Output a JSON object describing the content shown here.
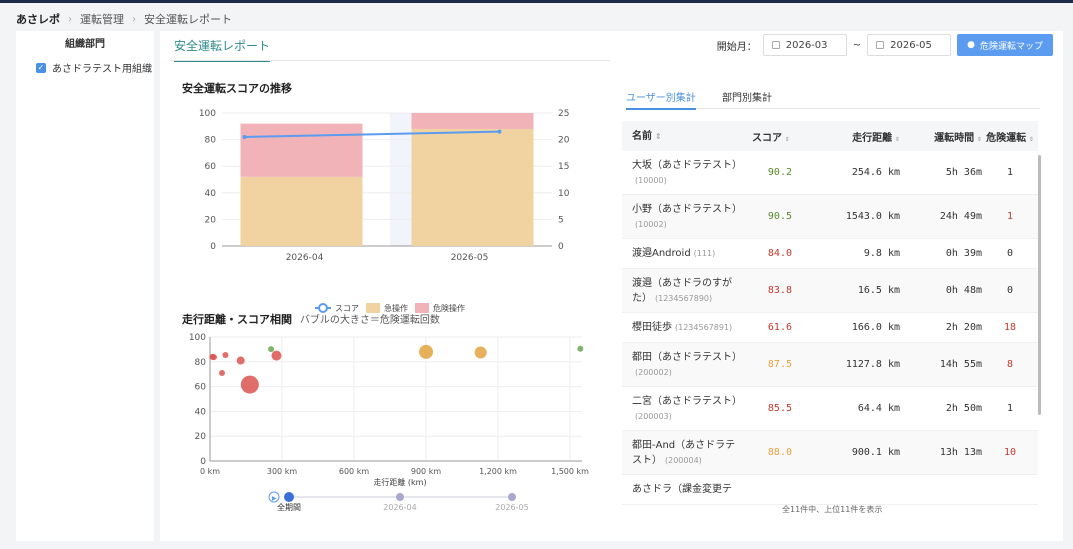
{
  "breadcrumb": {
    "home": "あさレポ",
    "level1": "運転管理",
    "level2": "安全運転レポート"
  },
  "sidebar": {
    "title": "組織部門",
    "org": "あさドラテスト用組織"
  },
  "main": {
    "tab": "安全運転レポート",
    "start_label": "開始月：",
    "start_value": "2026-03",
    "tilde": "~",
    "end_value": "2026-05",
    "map_button": "危険運転マップ"
  },
  "trend_chart": {
    "title": "安全運転スコアの推移",
    "left_ticks": [
      "100",
      "80",
      "60",
      "40",
      "20",
      "0"
    ],
    "right_ticks": [
      "25",
      "20",
      "15",
      "10",
      "5",
      "0"
    ],
    "categories": [
      "2026-04",
      "2026-05"
    ],
    "legend": {
      "score": "スコア",
      "sudden": "急操作",
      "danger": "危険操作"
    }
  },
  "bubble_chart": {
    "title": "走行距離・スコア相関",
    "subtitle": "バブルの大きさ＝危険運転回数",
    "y_ticks": [
      "100",
      "80",
      "60",
      "40",
      "20",
      "0"
    ],
    "x_ticks": [
      "0 km",
      "300 km",
      "600 km",
      "900 km",
      "1,200 km",
      "1,500 km"
    ],
    "xlabel": "走行距離 (km)",
    "timeline": [
      "全期間",
      "2026-04",
      "2026-05"
    ]
  },
  "chart_data": [
    {
      "type": "bar",
      "title": "安全運転スコアの推移",
      "categories": [
        "2026-04",
        "2026-05"
      ],
      "ylim_left": [
        0,
        100
      ],
      "ylim_right": [
        0,
        25
      ],
      "series": [
        {
          "name": "スコア",
          "type": "line",
          "axis": "right",
          "values": [
            20.5,
            21.5
          ]
        },
        {
          "name": "急操作",
          "type": "bar",
          "stack": "s",
          "axis": "left",
          "values": [
            52,
            88
          ]
        },
        {
          "name": "危険操作",
          "type": "bar",
          "stack": "s",
          "axis": "left",
          "values": [
            40,
            12
          ]
        }
      ]
    },
    {
      "type": "scatter",
      "title": "走行距離・スコア相関",
      "subtitle": "バブルの大きさ＝危険運転回数",
      "xlabel": "走行距離 (km)",
      "xlim": [
        0,
        1550
      ],
      "ylim": [
        0,
        100
      ],
      "points": [
        {
          "x": 9.8,
          "y": 84.0,
          "r": 3,
          "color": "#d9534f"
        },
        {
          "x": 16.5,
          "y": 83.8,
          "r": 3,
          "color": "#d9534f"
        },
        {
          "x": 64.4,
          "y": 85.5,
          "r": 3,
          "color": "#d9534f"
        },
        {
          "x": 50,
          "y": 71,
          "r": 3,
          "color": "#d9534f"
        },
        {
          "x": 128,
          "y": 81,
          "r": 4,
          "color": "#d9534f"
        },
        {
          "x": 166.0,
          "y": 61.6,
          "r": 9,
          "color": "#d9534f"
        },
        {
          "x": 254.6,
          "y": 90.2,
          "r": 3,
          "color": "#6aa84f"
        },
        {
          "x": 277,
          "y": 85,
          "r": 5,
          "color": "#d9534f"
        },
        {
          "x": 900.1,
          "y": 88.0,
          "r": 7,
          "color": "#e3a33f"
        },
        {
          "x": 1127.8,
          "y": 87.5,
          "r": 6,
          "color": "#e3a33f"
        },
        {
          "x": 1543.0,
          "y": 90.5,
          "r": 3,
          "color": "#6aa84f"
        }
      ]
    }
  ],
  "right_tabs": {
    "user": "ユーザー別集計",
    "dept": "部門別集計"
  },
  "table": {
    "headers": {
      "name": "名前",
      "score": "スコア",
      "distance": "走行距離",
      "time": "運転時間",
      "danger": "危険運転"
    },
    "rows": [
      {
        "name": "大坂（あさドラテスト）",
        "id": "(10000)",
        "score": "90.2",
        "distance": "254.6 km",
        "time": "5h 36m",
        "danger": "1",
        "score_color": "#5a8a2a",
        "danger_color": "#333"
      },
      {
        "name": "小野（あさドラテスト）",
        "id": "(10002)",
        "score": "90.5",
        "distance": "1543.0 km",
        "time": "24h 49m",
        "danger": "1",
        "score_color": "#5a8a2a",
        "danger_color": "#c0392b"
      },
      {
        "name": "渡邉Android",
        "id": "(111)",
        "score": "84.0",
        "distance": "9.8 km",
        "time": "0h 39m",
        "danger": "0",
        "score_color": "#c0392b",
        "danger_color": "#333"
      },
      {
        "name": "渡邉（あさドラのすがた）",
        "id": "(1234567890)",
        "score": "83.8",
        "distance": "16.5 km",
        "time": "0h 48m",
        "danger": "0",
        "score_color": "#c0392b",
        "danger_color": "#333"
      },
      {
        "name": "櫻田徒歩",
        "id": "(1234567891)",
        "score": "61.6",
        "distance": "166.0 km",
        "time": "2h 20m",
        "danger": "18",
        "score_color": "#c0392b",
        "danger_color": "#c0392b"
      },
      {
        "name": "都田（あさドラテスト）",
        "id": "(200002)",
        "score": "87.5",
        "distance": "1127.8 km",
        "time": "14h 55m",
        "danger": "8",
        "score_color": "#e3a33f",
        "danger_color": "#c0392b"
      },
      {
        "name": "二宮（あさドラテスト）",
        "id": "(200003)",
        "score": "85.5",
        "distance": "64.4 km",
        "time": "2h 50m",
        "danger": "1",
        "score_color": "#c0392b",
        "danger_color": "#333"
      },
      {
        "name": "都田-And（あさドラテスト）",
        "id": "(200004)",
        "score": "88.0",
        "distance": "900.1 km",
        "time": "13h 13m",
        "danger": "10",
        "score_color": "#e3a33f",
        "danger_color": "#c0392b"
      },
      {
        "name": "あさドラ（課金変更テ",
        "id": "",
        "score": "",
        "distance": "",
        "time": "",
        "danger": "",
        "score_color": "#333",
        "danger_color": "#333"
      }
    ],
    "footer": "全11件中、上位11件を表示"
  }
}
